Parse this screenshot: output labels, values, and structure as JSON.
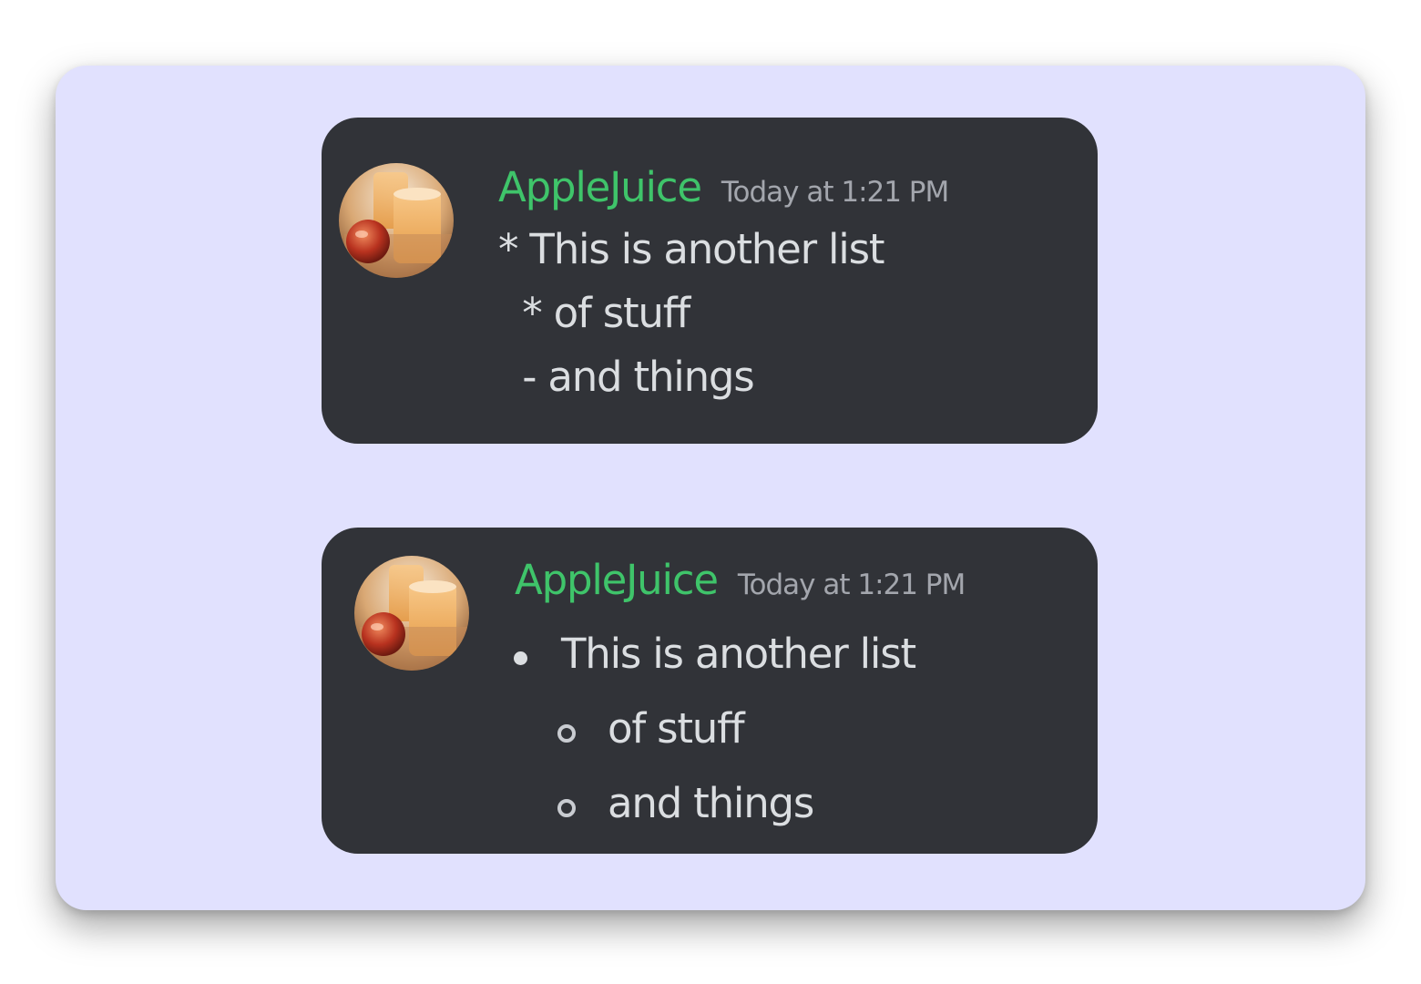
{
  "messages": [
    {
      "username": "AppleJuice",
      "timestamp": "Today at 1:21 PM",
      "avatar_icon": "apple-juice-avatar",
      "raw_lines": [
        "* This is another list",
        " * of stuff",
        " - and things"
      ]
    },
    {
      "username": "AppleJuice",
      "timestamp": "Today at 1:21 PM",
      "avatar_icon": "apple-juice-avatar",
      "list": {
        "items": [
          {
            "text": "This is another list",
            "level": 1
          },
          {
            "text": "of stuff",
            "level": 2
          },
          {
            "text": "and things",
            "level": 2
          }
        ]
      }
    }
  ],
  "colors": {
    "page_background": "#ffffff",
    "stage_background": "#e1e1fe",
    "card_background": "#313338",
    "username": "#3fc46a",
    "timestamp": "#a3a6ad",
    "message_text": "#dbdee1"
  }
}
